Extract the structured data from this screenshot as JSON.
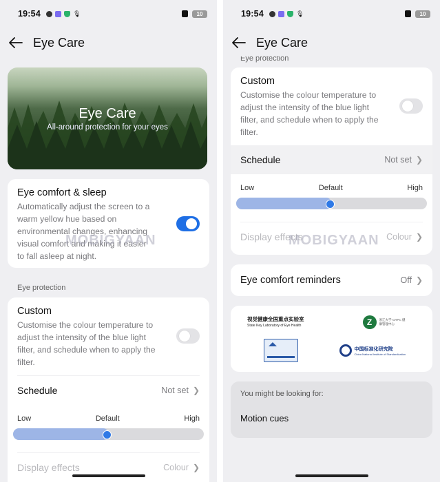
{
  "status": {
    "time": "19:54",
    "battery": "10"
  },
  "header": {
    "title": "Eye Care"
  },
  "hero": {
    "title": "Eye Care",
    "subtitle": "All-around protection for your eyes"
  },
  "eye_comfort": {
    "title": "Eye comfort & sleep",
    "description": "Automatically adjust the screen to a warm yellow hue based on environmental changes, enhancing visual comfort and making it easier to fall asleep at night.",
    "enabled": true
  },
  "eye_protection": {
    "section_label": "Eye protection",
    "custom_title": "Custom",
    "custom_description": "Customise the colour temperature to adjust the intensity of the blue light filter, and schedule when to apply the filter.",
    "custom_enabled": false,
    "schedule_label": "Schedule",
    "schedule_value": "Not set",
    "slider_low": "Low",
    "slider_default": "Default",
    "slider_high": "High",
    "slider_level": 0.5,
    "display_effects_label": "Display effects",
    "display_effects_value": "Colour"
  },
  "reminders": {
    "label": "Eye comfort reminders",
    "value": "Off"
  },
  "certifications": {
    "logo1_cn": "视觉健康全国重点实验室",
    "logo1_en": "State Key Laboratory of Eye Health",
    "logo2_text": "浙江大学·CRPC 健康管理中心",
    "logo4_cn": "中国标准化研究院",
    "logo4_en": "China National Institute of Standardization"
  },
  "suggestions": {
    "heading": "You might be looking for:",
    "item": "Motion cues"
  },
  "watermark": "MOBIGYAAN",
  "colors": {
    "accent": "#1f6fe5",
    "slider_fill": "#9db5e6",
    "background": "#efeff2"
  }
}
